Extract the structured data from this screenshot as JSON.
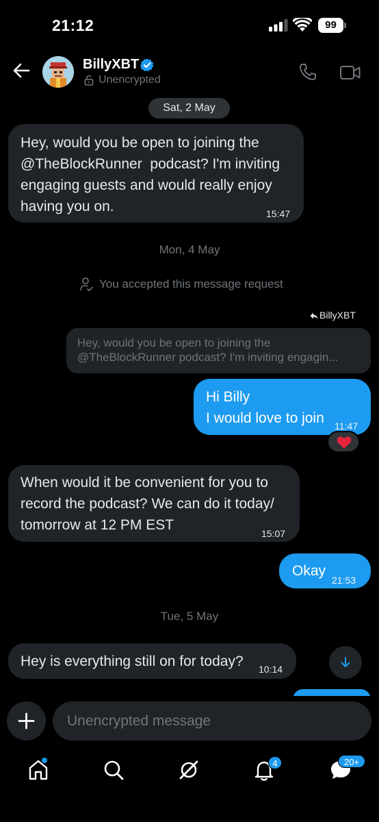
{
  "status_bar": {
    "time": "21:12",
    "battery": "99"
  },
  "header": {
    "contact_name": "BillyXBT",
    "encryption_label": "Unencrypted"
  },
  "messages": {
    "date_1": "Sat, 2 May",
    "msg_1": {
      "text": "Hey, would you be open to joining the\n@TheBlockRunner  podcast? I'm inviting\nengaging guests and would really enjoy\nhaving you on.",
      "time": "15:47"
    },
    "date_2": "Mon, 4 May",
    "system_note": "You accepted this message request",
    "reply_to_label": "BillyXBT",
    "quoted_line_1": "Hey, would you be open to joining the",
    "quoted_line_2": "@TheBlockRunner  podcast? I'm inviting engagin...",
    "msg_2": {
      "text": "Hi Billy\nI would love to join",
      "time": "11:47"
    },
    "reaction": "❤️",
    "msg_3": {
      "text": "When would it be convenient for you to\nrecord the podcast? We can do it today/\ntomorrow at 12 PM EST",
      "time": "15:07"
    },
    "msg_4": {
      "text": "Okay",
      "time": "21:53"
    },
    "date_3": "Tue, 5 May",
    "msg_5": {
      "text": "Hey is everything still on for today?",
      "time": "10:14"
    }
  },
  "composer": {
    "placeholder": "Unencrypted message"
  },
  "tab_bar": {
    "tabs": [
      "home-tab",
      "search-tab",
      "grok-tab",
      "notifications-tab",
      "messages-tab"
    ],
    "notifications_badge": "4",
    "messages_badge": "20+"
  },
  "colors": {
    "accent": "#1d9bf0",
    "incoming_bubble": "#202327",
    "background": "#000000",
    "muted_text": "#71767b"
  }
}
